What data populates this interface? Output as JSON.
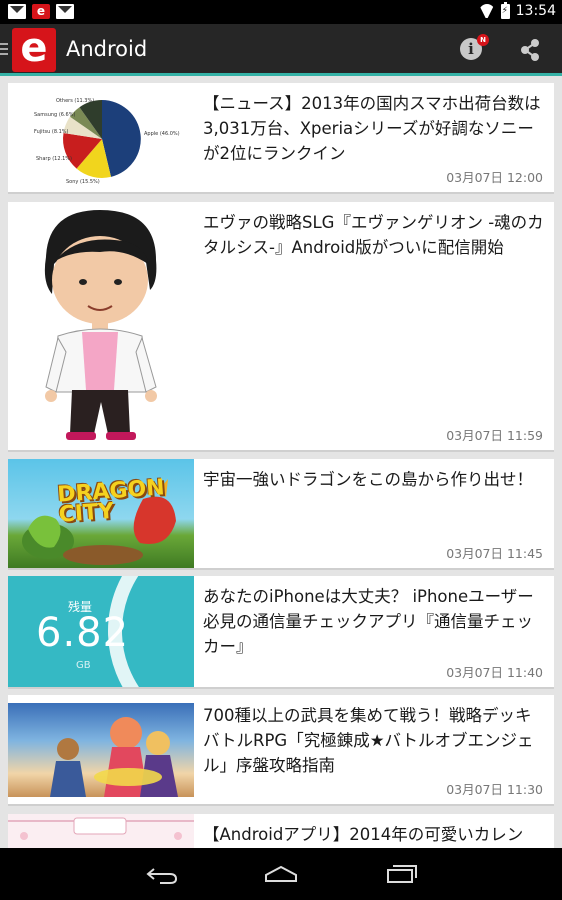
{
  "status_bar": {
    "time": "13:54",
    "notification_icons": [
      "gmail-icon",
      "e-app-icon",
      "gmail-icon"
    ],
    "system_icons": [
      "wifi-icon",
      "battery-charging-icon"
    ]
  },
  "action_bar": {
    "logo_letter": "e",
    "title": "Android",
    "info_badge": "N",
    "colors": {
      "bar": "#262626",
      "accent": "#35b2a6",
      "logo": "#d6141a"
    }
  },
  "pie_chart": {
    "labels": [
      "Others (11.3%)",
      "Samsung (6.6%)",
      "Fujitsu (8.1%)",
      "Sharp (12.1%)",
      "Sony (15.5%)",
      "Apple (46.0%)"
    ]
  },
  "meter": {
    "label": "残量",
    "value": "6.82",
    "unit": "GB"
  },
  "articles": [
    {
      "title": "【ニュース】2013年の国内スマホ出荷台数は3,031万台、Xperiaシリーズが好調なソニーが2位にランクイン",
      "time": "03月07日 12:00"
    },
    {
      "title": "エヴァの戦略SLG『エヴァンゲリオン -魂のカタルシス-』Android版がついに配信開始",
      "time": "03月07日 11:59"
    },
    {
      "title": "宇宙一強いドラゴンをこの島から作り出せ！",
      "time": "03月07日 11:45",
      "thumb_text": "DRAGON CITY"
    },
    {
      "title": "あなたのiPhoneは大丈夫？ iPhoneユーザー必見の通信量チェックアプリ『通信量チェッカー』",
      "time": "03月07日 11:40"
    },
    {
      "title": "700種以上の武具を集めて戦う！戦略デッキバトルRPG「究極錬成★バトルオブエンジェル」序盤攻略指南",
      "time": "03月07日 11:30"
    },
    {
      "title": "【Androidアプリ】2014年の可愛いカレン",
      "time": ""
    }
  ]
}
